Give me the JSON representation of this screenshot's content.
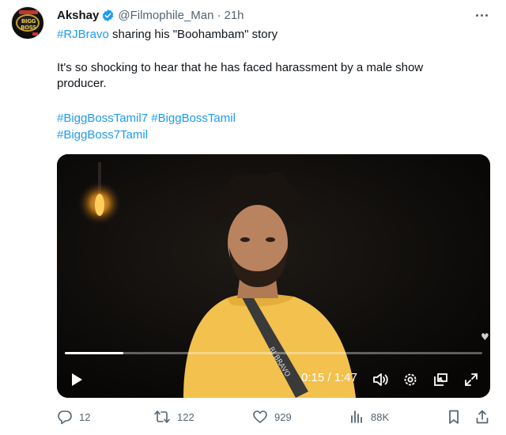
{
  "author": {
    "name": "Akshay",
    "handle": "@Filmophile_Man",
    "separator": "·",
    "time": "21h",
    "avatar_text": "BIGG BOSS"
  },
  "tweet": {
    "line1_hashtag": "#RJBravo",
    "line1_text": " sharing his \"Boohambam\" story",
    "line2": "It's so shocking to hear that he has faced harassment by a male show",
    "line3": "producer.",
    "hashtags_line1": "#BiggBossTamil7 #BiggBossTamil",
    "hashtags_line2": "#BiggBoss7Tamil"
  },
  "video": {
    "current_time": "0:15",
    "time_separator": "/",
    "duration": "1:47",
    "progress_fraction": 0.14,
    "shirt_text": "RJ BRAVO"
  },
  "stats": {
    "replies": "12",
    "reposts": "122",
    "likes": "929",
    "views": "88K"
  },
  "colors": {
    "link": "#1d9bf0",
    "muted": "#536471",
    "verified": "#1d9bf0",
    "shirt": "#f2c14e"
  },
  "icons": [
    "verified-badge-icon",
    "more-icon",
    "play-icon",
    "volume-icon",
    "settings-icon",
    "minimize-icon",
    "fullscreen-icon",
    "reply-icon",
    "repost-icon",
    "like-icon",
    "views-icon",
    "bookmark-icon",
    "share-icon"
  ]
}
